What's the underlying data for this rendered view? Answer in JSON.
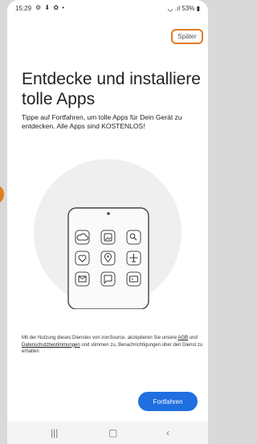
{
  "status_bar": {
    "time": "15:29",
    "icons": "⚙ ⬇ ✿ •",
    "battery": "53%"
  },
  "skip_label": "Später",
  "headline": "Entdecke und installiere tolle Apps",
  "subtitle": "Tippe auf Fortfahren, um tolle Apps für Dein Gerät zu entdecken. Alle Apps sind KOSTENLOS!",
  "legal": {
    "part1": "Mit der Nutzung dieses Dienstes von ironSource, akzeptieren Sie unsere ",
    "agb_link": "AGB",
    "part2": " und ",
    "privacy_link": "Datenschutzbestimmungen",
    "part3": " und stimmen zu, Benachrichtigungen über den Dienst zu erhalten"
  },
  "continue_label": "Fortfahren",
  "illustration_icons": [
    "cloud-icon",
    "image-icon",
    "search-icon",
    "heart-icon",
    "location-pin-icon",
    "airplane-icon",
    "mail-icon",
    "chat-icon",
    "card-icon"
  ],
  "colors": {
    "accent": "#1f6fe0",
    "highlight": "#e07d1f"
  }
}
